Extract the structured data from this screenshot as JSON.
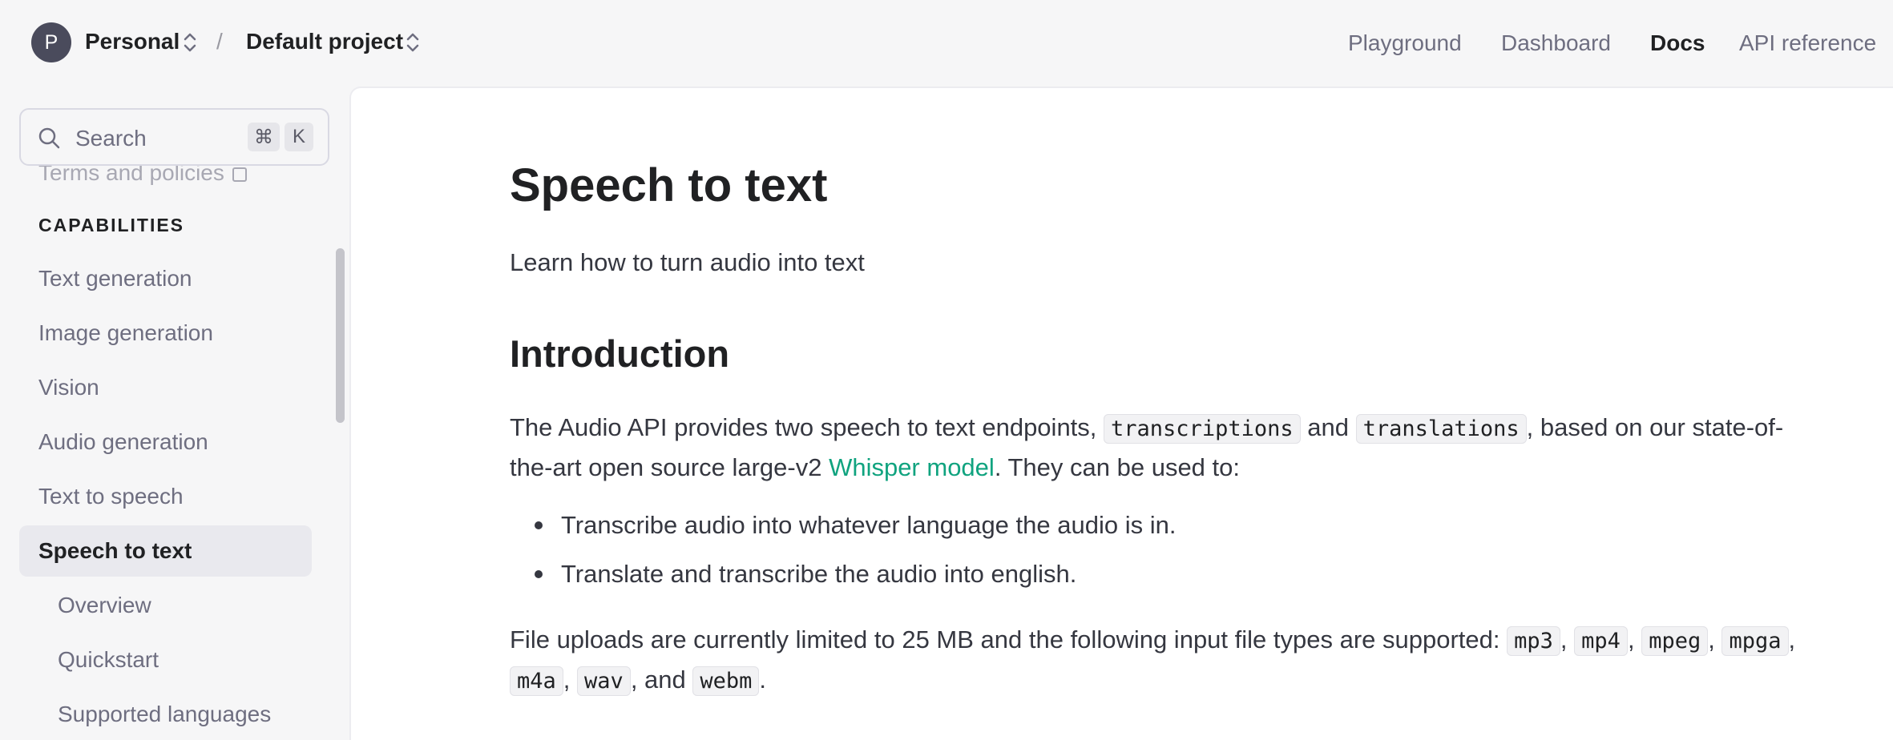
{
  "header": {
    "org_initial": "P",
    "org_name": "Personal",
    "separator": "/",
    "project_name": "Default project",
    "nav": [
      "Playground",
      "Dashboard",
      "Docs",
      "API reference"
    ],
    "active_nav": "Docs"
  },
  "sidebar": {
    "search_placeholder": "Search",
    "shortcut_keys": [
      "⌘",
      "K"
    ],
    "faded_item": "Terms and policies",
    "section_heading": "CAPABILITIES",
    "items": [
      {
        "label": "Text generation"
      },
      {
        "label": "Image generation"
      },
      {
        "label": "Vision"
      },
      {
        "label": "Audio generation"
      },
      {
        "label": "Text to speech"
      },
      {
        "label": "Speech to text",
        "active": true
      }
    ],
    "sub_items": [
      {
        "label": "Overview"
      },
      {
        "label": "Quickstart"
      },
      {
        "label": "Supported languages"
      }
    ]
  },
  "main": {
    "title": "Speech to text",
    "subtitle": "Learn how to turn audio into text",
    "section_title": "Introduction",
    "intro": {
      "p1": "The Audio API provides two speech to text endpoints,",
      "code1": "transcriptions",
      "p2": "and",
      "code2": "translations",
      "p3": ", based on our state-of-",
      "p4": "the-art open source large-v2",
      "link": "Whisper model",
      "p5": ". They can be used to:"
    },
    "bullets": [
      "Transcribe audio into whatever language the audio is in.",
      "Translate and transcribe the audio into english."
    ],
    "uploads": {
      "text": "File uploads are currently limited to 25 MB and the following input file types are supported:",
      "types": [
        "mp3",
        "mp4",
        "mpeg",
        "mpga",
        "m4a",
        "wav",
        "webm"
      ],
      "and": ", and",
      "comma": ",",
      "period": "."
    }
  },
  "colors": {
    "link": "#10a37f",
    "active_bg": "#e9e9ee",
    "avatar_bg": "#4a4b5c"
  }
}
